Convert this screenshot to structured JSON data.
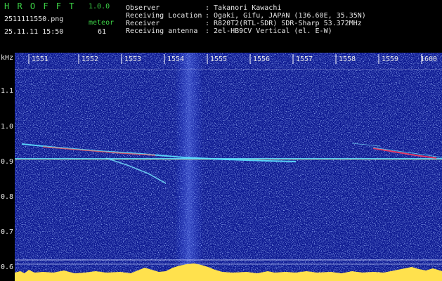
{
  "header": {
    "app_name": "H R O F F T",
    "version": "1.0.0",
    "filename": "2511111550.png",
    "datetime": "25.11.11 15:50",
    "meteor_label": "meteor",
    "meteor_count": "61",
    "info_labels": [
      "Observer",
      "Receiving Location",
      "Receiver",
      "Receiving antenna"
    ],
    "info_values": [
      ": Takanori Kawachi",
      ": Ogaki, Gifu, JAPAN (136.60E, 35.35N)",
      ": R820T2(RTL-SDR) SDR-Sharp 53.372MHz",
      ": 2el-HB9CV Vertical (el. E-W)"
    ]
  },
  "axes": {
    "y_unit": "kHz",
    "y_ticks": [
      "1.1",
      "1.0",
      "0.9",
      "0.8",
      "0.7",
      "0.6"
    ],
    "x_ticks": [
      "1551",
      "1552",
      "1553",
      "1554",
      "1555",
      "1556",
      "1557",
      "1558",
      "1559",
      "1600"
    ]
  },
  "colors": {
    "label_green": "#3cd246",
    "text_white": "#e8e8e8",
    "background_blue": "#0b1790",
    "signal_yellow": "#ffe14d"
  }
}
